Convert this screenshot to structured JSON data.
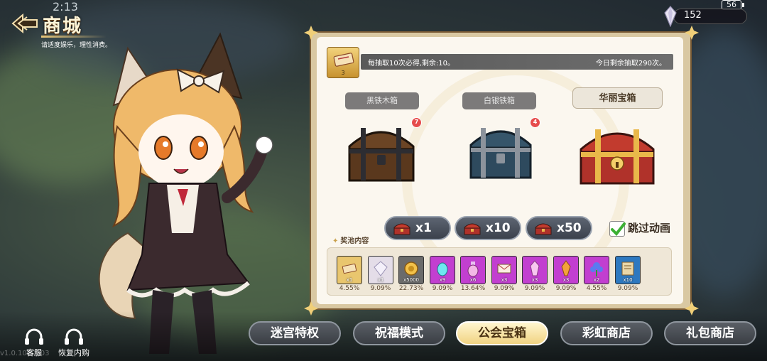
{
  "status": {
    "time": "2:13",
    "battery": "56"
  },
  "header": {
    "title": "商城",
    "subtitle": "请适度娱乐，理性消费。"
  },
  "currency": {
    "amount": "152",
    "icon": "crystal-icon"
  },
  "draw_info": {
    "ticket_count": "3",
    "guarantee": "每抽取10次必得,剩余:10。",
    "remaining_today": "今日剩余抽取290次。"
  },
  "chests": [
    {
      "name": "黑铁木箱",
      "badge": "7",
      "selected": false
    },
    {
      "name": "白银铁箱",
      "badge": "4",
      "selected": false
    },
    {
      "name": "华丽宝箱",
      "badge": "",
      "selected": true
    }
  ],
  "draw_buttons": [
    {
      "label": "x1"
    },
    {
      "label": "x10"
    },
    {
      "label": "x50"
    }
  ],
  "skip_animation": {
    "label": "跳过动画",
    "checked": true
  },
  "pool": {
    "title": "奖池内容",
    "items": [
      {
        "icon": "ticket-icon",
        "qty": "x1",
        "rate": "4.55%",
        "color": "#e9c66e"
      },
      {
        "icon": "white-crystal-icon",
        "qty": "x1",
        "rate": "9.09%",
        "color": "#e4dde8"
      },
      {
        "icon": "coin-icon",
        "qty": "x5000",
        "rate": "22.73%",
        "color": "#6b6b6b"
      },
      {
        "icon": "cyan-egg-icon",
        "qty": "x9",
        "rate": "9.09%",
        "color": "#c23fd0"
      },
      {
        "icon": "potion-icon",
        "qty": "x6",
        "rate": "13.64%",
        "color": "#c23fd0"
      },
      {
        "icon": "letter-icon",
        "qty": "x3",
        "rate": "9.09%",
        "color": "#c23fd0"
      },
      {
        "icon": "pink-crystal-icon",
        "qty": "x3",
        "rate": "9.09%",
        "color": "#c23fd0"
      },
      {
        "icon": "orange-crystal-icon",
        "qty": "x3",
        "rate": "9.09%",
        "color": "#c23fd0"
      },
      {
        "icon": "blue-flower-icon",
        "qty": "x2",
        "rate": "4.55%",
        "color": "#c23fd0"
      },
      {
        "icon": "scroll-icon",
        "qty": "x10",
        "rate": "9.09%",
        "color": "#2d78c0"
      }
    ]
  },
  "nav": [
    {
      "label": "迷宫特权",
      "active": false
    },
    {
      "label": "祝福模式",
      "active": false
    },
    {
      "label": "公会宝箱",
      "active": true
    },
    {
      "label": "彩虹商店",
      "active": false
    },
    {
      "label": "礼包商店",
      "active": false
    }
  ],
  "helpers": [
    {
      "label": "客服",
      "icon": "headset-icon"
    },
    {
      "label": "恢复内购",
      "icon": "headset-icon"
    }
  ],
  "version": "v1.0.1080203"
}
